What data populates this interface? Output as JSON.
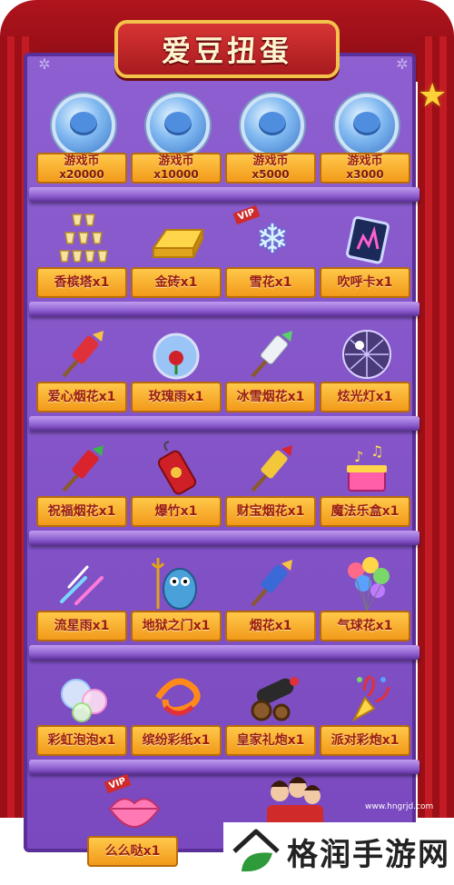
{
  "title": "爱豆扭蛋",
  "watermark": "www.hngrjd.com",
  "logo": {
    "text": "格润手游网"
  },
  "colors": {
    "cabinet": "#8d5fd0",
    "label": "#ffc84a",
    "label_text": "#9a1c10",
    "curtain": "#b0141c"
  },
  "shelves": [
    {
      "items": [
        {
          "name": "游戏币",
          "qty": "x20000",
          "icon": "coin-icon"
        },
        {
          "name": "游戏币",
          "qty": "x10000",
          "icon": "coin-icon"
        },
        {
          "name": "游戏币",
          "qty": "x5000",
          "icon": "coin-icon"
        },
        {
          "name": "游戏币",
          "qty": "x3000",
          "icon": "coin-icon"
        }
      ]
    },
    {
      "items": [
        {
          "name": "香槟塔x1",
          "icon": "champagne-tower-icon"
        },
        {
          "name": "金砖x1",
          "icon": "gold-bar-icon"
        },
        {
          "name": "雪花x1",
          "icon": "snowflake-icon",
          "badge": "VIP"
        },
        {
          "name": "吹呼卡x1",
          "icon": "card-icon"
        }
      ]
    },
    {
      "items": [
        {
          "name": "爱心烟花x1",
          "icon": "firework-rocket-icon"
        },
        {
          "name": "玫瑰雨x1",
          "icon": "rose-globe-icon"
        },
        {
          "name": "冰雪烟花x1",
          "icon": "firework-rocket-icon"
        },
        {
          "name": "炫光灯x1",
          "icon": "disco-ball-icon"
        }
      ]
    },
    {
      "items": [
        {
          "name": "祝福烟花x1",
          "icon": "firework-rocket-icon"
        },
        {
          "name": "爆竹x1",
          "icon": "firecracker-icon"
        },
        {
          "name": "财宝烟花x1",
          "icon": "firework-rocket-icon"
        },
        {
          "name": "魔法乐盒x1",
          "icon": "music-box-icon"
        }
      ]
    },
    {
      "items": [
        {
          "name": "流星雨x1",
          "icon": "meteor-shower-icon"
        },
        {
          "name": "地狱之门x1",
          "icon": "monster-icon"
        },
        {
          "name": "烟花x1",
          "icon": "firework-rocket-icon"
        },
        {
          "name": "气球花x1",
          "icon": "balloons-icon"
        }
      ]
    },
    {
      "items": [
        {
          "name": "彩虹泡泡x1",
          "icon": "bubbles-icon"
        },
        {
          "name": "缤纷彩纸x1",
          "icon": "confetti-ribbon-icon"
        },
        {
          "name": "皇家礼炮x1",
          "icon": "cannon-icon"
        },
        {
          "name": "派对彩炮x1",
          "icon": "party-popper-icon"
        }
      ]
    },
    {
      "items": [
        {
          "name": "么么哒x1",
          "icon": "lips-icon",
          "badge": "VIP"
        }
      ]
    }
  ]
}
